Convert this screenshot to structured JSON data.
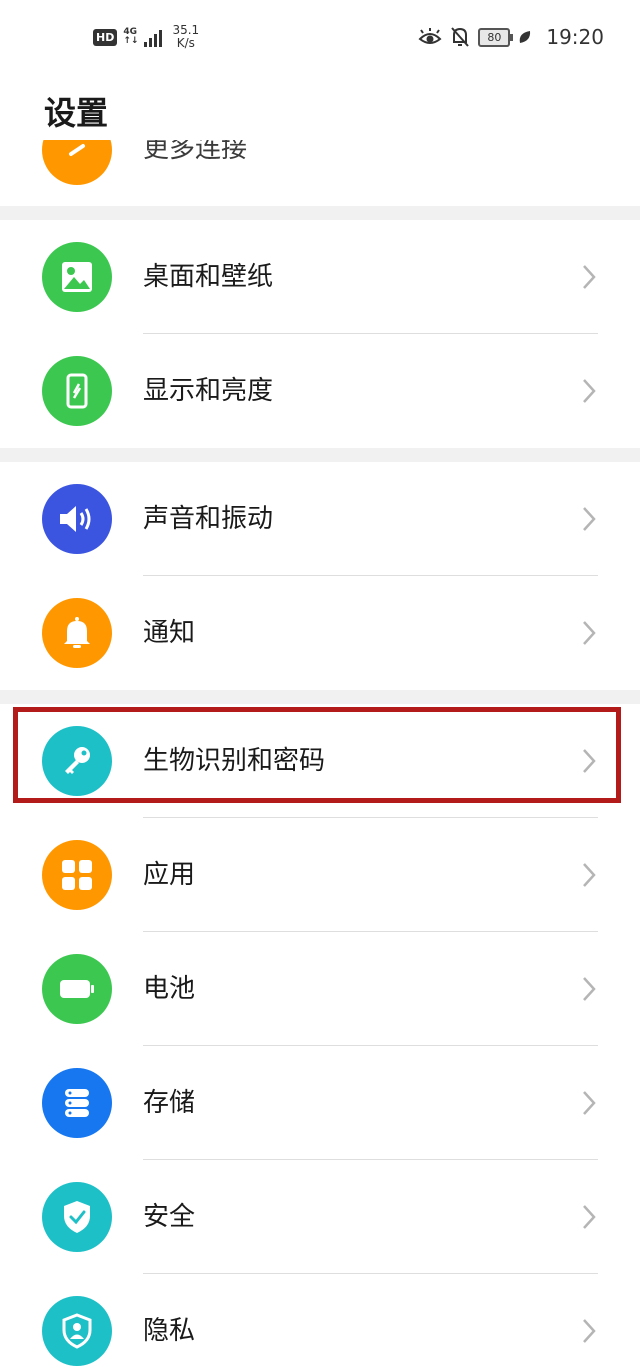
{
  "status_bar": {
    "hd": "HD",
    "network_top": "4G",
    "network_bottom": "↑↓",
    "speed_value": "35.1",
    "speed_unit": "K/s",
    "battery": "80",
    "time": "19:20"
  },
  "page": {
    "title": "设置"
  },
  "items": {
    "more_connections": {
      "label": "更多连接",
      "icon": "link-icon",
      "color": "#FF9800"
    },
    "desktop_wallpaper": {
      "label": "桌面和壁纸",
      "icon": "image-icon",
      "color": "#3CC850"
    },
    "display_brightness": {
      "label": "显示和亮度",
      "icon": "phone-display-icon",
      "color": "#3CC850"
    },
    "sound_vibration": {
      "label": "声音和振动",
      "icon": "speaker-icon",
      "color": "#3B55E0"
    },
    "notifications": {
      "label": "通知",
      "icon": "bell-icon",
      "color": "#FF9800"
    },
    "biometrics_password": {
      "label": "生物识别和密码",
      "icon": "key-icon",
      "color": "#1EC0C8"
    },
    "apps": {
      "label": "应用",
      "icon": "apps-grid-icon",
      "color": "#FF9800"
    },
    "battery": {
      "label": "电池",
      "icon": "battery-icon",
      "color": "#3CC850"
    },
    "storage": {
      "label": "存储",
      "icon": "storage-icon",
      "color": "#1677F0"
    },
    "security": {
      "label": "安全",
      "icon": "shield-check-icon",
      "color": "#1EC0C8"
    },
    "privacy": {
      "label": "隐私",
      "icon": "privacy-user-icon",
      "color": "#1EC0C8"
    }
  },
  "highlight_color": "#B31B1B"
}
